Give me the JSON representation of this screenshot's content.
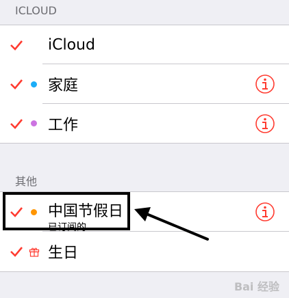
{
  "sections": {
    "icloud_header": "ICLOUD",
    "other_header": "其他"
  },
  "icloud": {
    "account_label": "iCloud",
    "calendars": [
      {
        "label": "家庭",
        "color": "#1badf8"
      },
      {
        "label": "工作",
        "color": "#cc73e1"
      }
    ]
  },
  "other": {
    "calendars": [
      {
        "label": "中国节假日",
        "sublabel": "已订阅的",
        "color": "#ff9500"
      },
      {
        "label": "生日",
        "icon": "gift-icon"
      }
    ]
  },
  "colors": {
    "check": "#ff3b30",
    "info": "#ff3b30",
    "background": "#efeff4"
  },
  "watermark": "Bai 经验"
}
